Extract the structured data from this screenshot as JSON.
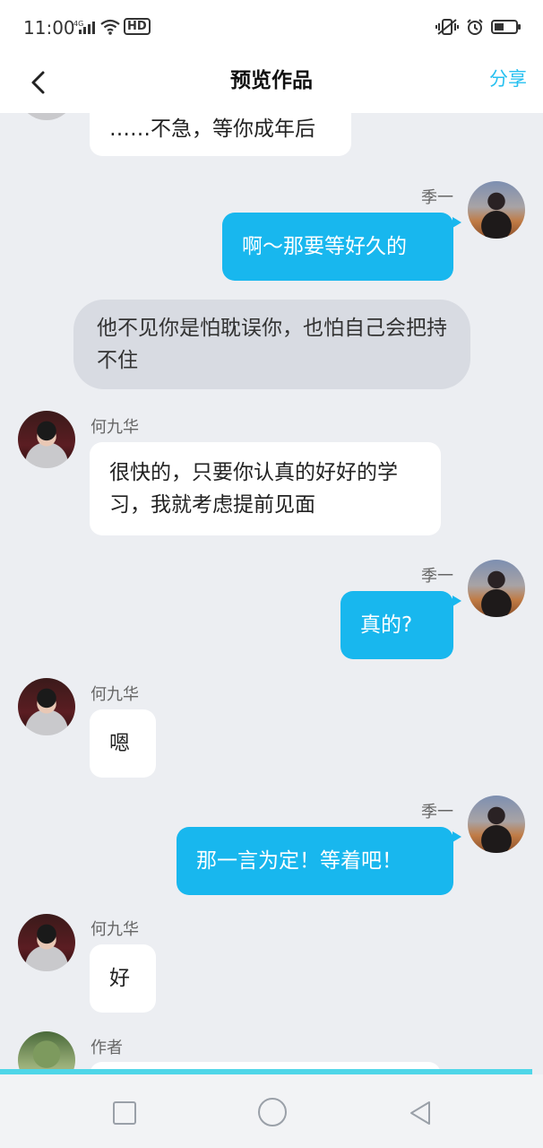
{
  "status_bar": {
    "time": "11:00",
    "network": "4G",
    "hd": "HD"
  },
  "header": {
    "title": "预览作品",
    "share_label": "分享"
  },
  "messages": [
    {
      "side": "left",
      "sender": "",
      "text": "……不急，等你成年后"
    },
    {
      "side": "right",
      "sender": "季一",
      "text": "啊～那要等好久的"
    },
    {
      "side": "center",
      "sender": "",
      "text": "他不见你是怕耽误你，也怕自己会把持不住"
    },
    {
      "side": "left",
      "sender": "何九华",
      "text": "很快的，只要你认真的好好的学习，我就考虑提前见面"
    },
    {
      "side": "right",
      "sender": "季一",
      "text": "真的?"
    },
    {
      "side": "left",
      "sender": "何九华",
      "text": "嗯"
    },
    {
      "side": "right",
      "sender": "季一",
      "text": "那一言为定！等着吧！"
    },
    {
      "side": "left",
      "sender": "何九华",
      "text": "好"
    },
    {
      "side": "left",
      "sender": "作者",
      "text": ""
    }
  ],
  "colors": {
    "accent": "#18b7ee",
    "share": "#27c0f0",
    "background": "#eceef2"
  }
}
